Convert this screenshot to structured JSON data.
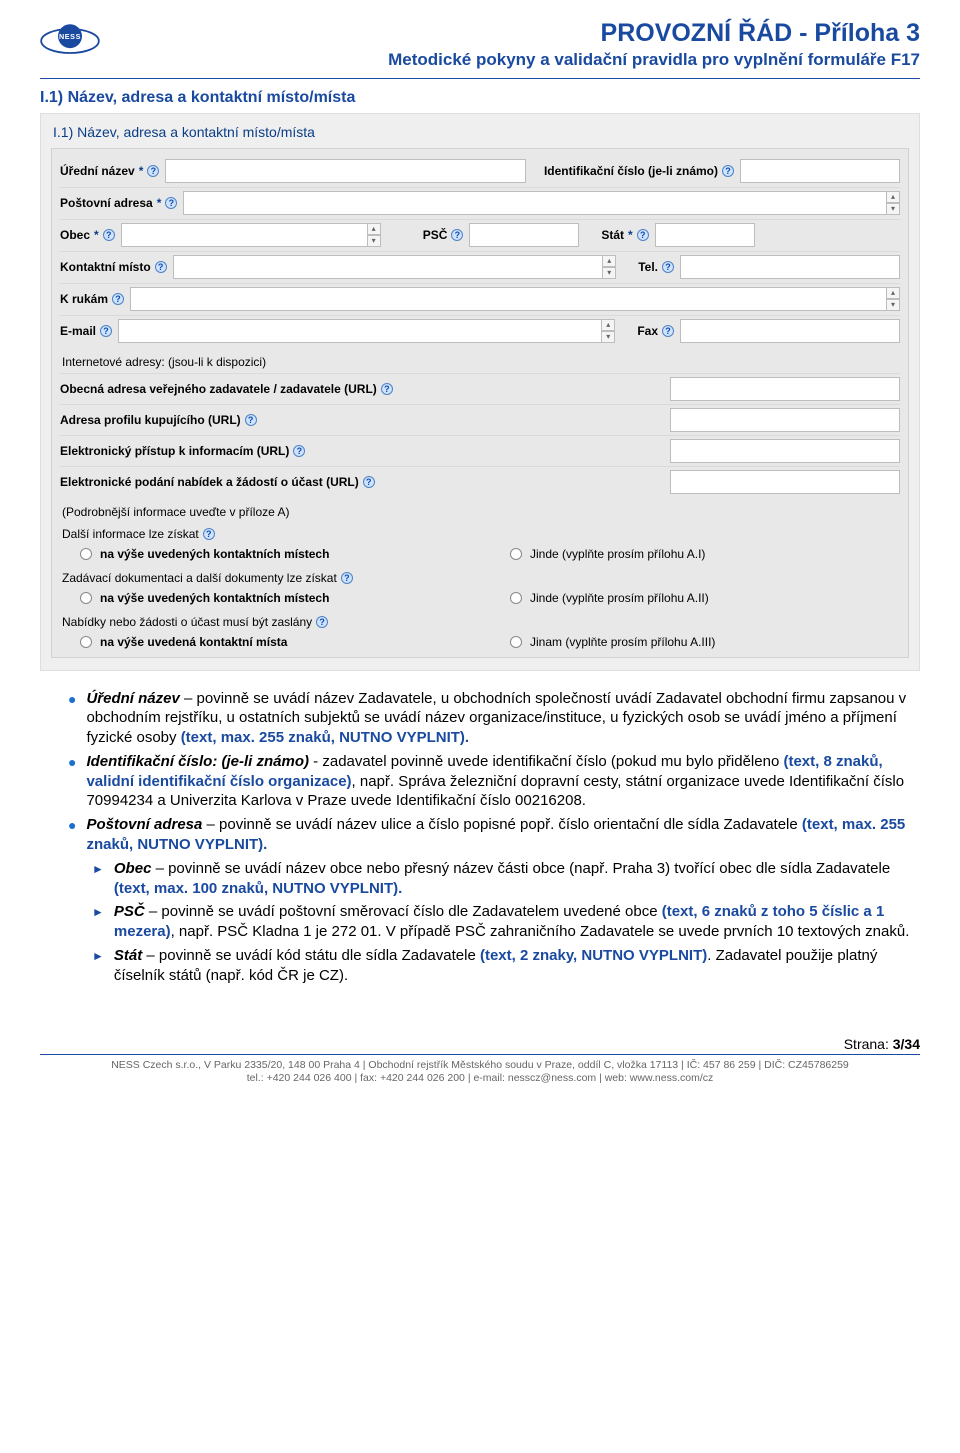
{
  "header": {
    "title_main": "PROVOZNÍ ŘÁD - Příloha 3",
    "title_sub": "Metodické pokyny a validační pravidla pro vyplnění formuláře F17"
  },
  "section_title": "I.1) Název, adresa a kontaktní místo/místa",
  "form": {
    "subheader": "I.1) Název, adresa a kontaktní místo/místa",
    "label_uredni_nazev": "Úřední název",
    "label_id_cislo": "Identifikační číslo (je-li známo)",
    "label_postovni_adresa": "Poštovní adresa",
    "label_obec": "Obec",
    "label_psc": "PSČ",
    "label_stat": "Stát",
    "label_kontaktni_misto": "Kontaktní místo",
    "label_tel": "Tel.",
    "label_k_rukam": "K rukám",
    "label_email": "E-mail",
    "label_fax": "Fax",
    "note_internet": "Internetové adresy: (jsou-li k dispozici)",
    "url_obecna": "Obecná adresa veřejného zadavatele / zadavatele (URL)",
    "url_profil": "Adresa profilu kupujícího (URL)",
    "url_elektr_pristup": "Elektronický přístup k informacím (URL)",
    "url_elektr_podani": "Elektronické podání nabídek a žádostí o účast (URL)",
    "note_priloha": "(Podrobnější informace uveďte v příloze A)",
    "radio1_label": "Další informace lze získat",
    "radio1_opt1": "na výše uvedených kontaktních místech",
    "radio1_opt2": "Jinde (vyplňte prosím přílohu A.I)",
    "radio2_label": "Zadávací dokumentaci a další dokumenty lze získat",
    "radio2_opt1": "na výše uvedených kontaktních místech",
    "radio2_opt2": "Jinde (vyplňte prosím přílohu A.II)",
    "radio3_label": "Nabídky nebo žádosti o účast musí být zaslány",
    "radio3_opt1": "na výše uvedená kontaktní místa",
    "radio3_opt2": "Jinam (vyplňte prosím přílohu A.III)"
  },
  "bullets": {
    "b1_prefix": "Úřední název",
    "b1_text": " – povinně se uvádí název Zadavatele, u obchodních společností uvádí Zadavatel obchodní firmu zapsanou v obchodním rejstříku, u ostatních subjektů se uvádí název organizace/instituce, u fyzických osob se uvádí jméno a příjmení fyzické osoby ",
    "b1_hl": "(text, max. 255 znaků, NUTNO VYPLNIT).",
    "b2_prefix": "Identifikační číslo: (je-li známo)",
    "b2_text1": " -  zadavatel povinně uvede identifikační číslo (pokud mu bylo přiděleno ",
    "b2_hl": "(text, 8 znaků, validní identifikační číslo organizace)",
    "b2_text2": ", např. Správa železniční dopravní cesty, státní organizace uvede Identifikační číslo 70994234 a Univerzita Karlova v Praze uvede Identifikační číslo 00216208.",
    "b3_prefix": "Poštovní adresa",
    "b3_text": " – povinně se uvádí název ulice a číslo popisné popř. číslo orientační dle sídla Zadavatele ",
    "b3_hl": "(text, max. 255 znaků, NUTNO VYPLNIT).",
    "b4_prefix": "Obec",
    "b4_text1": " – povinně se uvádí název obce nebo přesný název části obce (např. Praha 3) tvořící obec dle sídla Zadavatele ",
    "b4_hl": "(text, max. 100 znaků, NUTNO VYPLNIT).",
    "b5_prefix": "PSČ",
    "b5_text1": " – povinně se uvádí poštovní směrovací číslo dle Zadavatelem uvedené obce ",
    "b5_hl": "(text, 6 znaků z toho 5 číslic a 1 mezera)",
    "b5_text2": ", např. PSČ Kladna 1 je 272 01. V případě PSČ zahraničního Zadavatele se uvede prvních 10 textových znaků.",
    "b6_prefix": "Stát",
    "b6_text1": " – povinně se uvádí kód státu dle sídla Zadavatele ",
    "b6_hl": "(text, 2 znaky, NUTNO VYPLNIT)",
    "b6_text2": ". Zadavatel použije platný číselník států (např. kód ČR je CZ)."
  },
  "footer": {
    "page_label": "Strana:",
    "page_num": "3/34",
    "line1": "NESS Czech s.r.o., V Parku 2335/20, 148 00 Praha 4 | Obchodní rejstřík Městského soudu v Praze, oddíl C, vložka 17113 | IČ: 457 86 259 | DIČ: CZ45786259",
    "line2": "tel.: +420 244 026 400 | fax: +420 244 026 200 | e-mail: nesscz@ness.com | web: www.ness.com/cz"
  }
}
